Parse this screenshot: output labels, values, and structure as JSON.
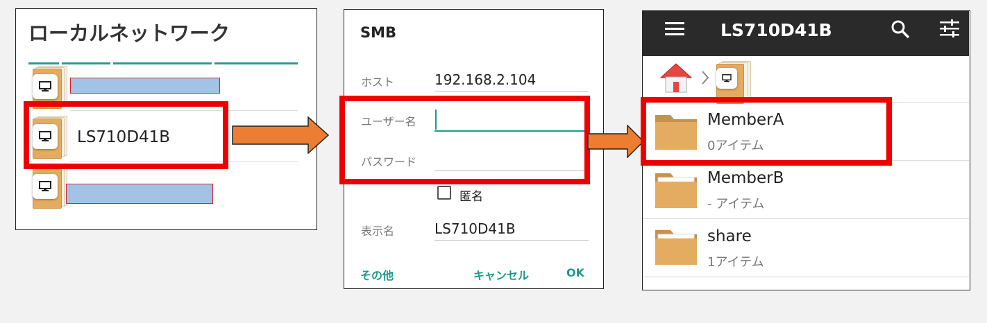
{
  "colors": {
    "highlight": "#ee0000",
    "accent": "#1b9a8a",
    "folder": "#e3ac60",
    "appbar": "#2a2a2a",
    "redaction": "#a3c3e6",
    "arrow": "#ed7d31"
  },
  "panel1": {
    "title": "ローカルネットワーク",
    "devices": [
      {
        "name": "",
        "icon": "monitor-icon"
      },
      {
        "name": "LS710D41B",
        "icon": "monitor-icon"
      },
      {
        "name": "",
        "icon": "monitor-icon"
      }
    ]
  },
  "panel2": {
    "title": "SMB",
    "host_label": "ホスト",
    "host_value": "192.168.2.104",
    "user_label": "ユーザー名",
    "user_value": "",
    "password_label": "パスワード",
    "password_value": "",
    "anonymous_label": "匿名",
    "display_label": "表示名",
    "display_value": "LS710D41B",
    "btn_more": "その他",
    "btn_cancel": "キャンセル",
    "btn_ok": "OK"
  },
  "panel3": {
    "title": "LS710D41B",
    "icons": [
      "menu-icon",
      "search-icon",
      "settings-icon",
      "home-icon",
      "chevron-right-icon",
      "monitor-icon"
    ],
    "rows": [
      {
        "name": "MemberA",
        "sub": "0アイテム"
      },
      {
        "name": "MemberB",
        "sub": "- アイテム"
      },
      {
        "name": "share",
        "sub": "1アイテム"
      }
    ]
  }
}
